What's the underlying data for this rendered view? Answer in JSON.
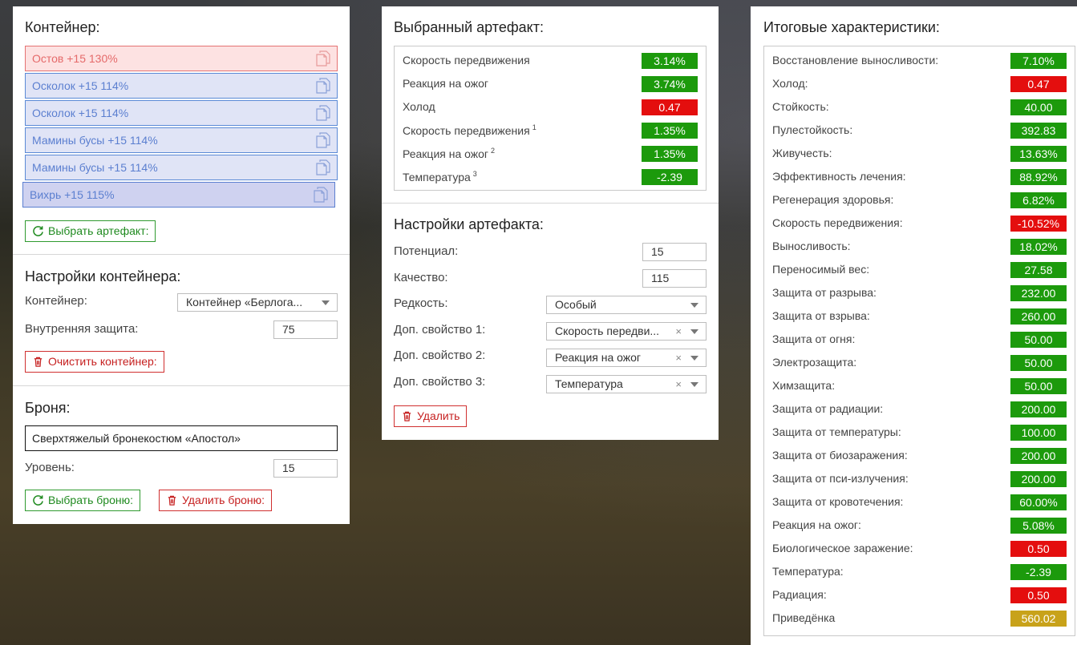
{
  "colors": {
    "positive": "#1c9a0c",
    "negative": "#e40e0e",
    "neutral": "#c8a21a",
    "slot_blue": "#5b7fd0",
    "slot_red": "#e56a6a",
    "btn_green": "#1f8a1f",
    "btn_red": "#c62020"
  },
  "container": {
    "title": "Контейнер:",
    "slots": [
      {
        "label": "Остов +15 130%",
        "style": "red",
        "icon": "copy-doc-icon"
      },
      {
        "label": "Осколок +15 114%",
        "style": "blue",
        "icon": "copy-doc-icon"
      },
      {
        "label": "Осколок +15 114%",
        "style": "blue",
        "icon": "copy-doc-icon"
      },
      {
        "label": "Мамины бусы +15 114%",
        "style": "blue",
        "icon": "copy-doc-icon"
      },
      {
        "label": "Мамины бусы +15 114%",
        "style": "blue",
        "icon": "copy-doc-icon"
      },
      {
        "label": "Вихрь +15 115%",
        "style": "active",
        "icon": "copy-doc-icon"
      }
    ],
    "select_artifact_label": "Выбрать артефакт:"
  },
  "container_settings": {
    "title": "Настройки контейнера:",
    "container_label": "Контейнер:",
    "container_value": "Контейнер «Берлога...",
    "internal_protection_label": "Внутренняя защита:",
    "internal_protection_value": "75",
    "clear_label": "Очистить контейнер:"
  },
  "armor": {
    "title": "Броня:",
    "name": "Сверхтяжелый бронекостюм «Апостол»",
    "level_label": "Уровень:",
    "level_value": "15",
    "select_label": "Выбрать броню:",
    "delete_label": "Удалить броню:"
  },
  "selected_artifact": {
    "title": "Выбранный артефакт:",
    "stats": [
      {
        "name": "Скорость передвижения",
        "sup": "",
        "value": "3.14%",
        "tone": "green"
      },
      {
        "name": "Реакция на ожог",
        "sup": "",
        "value": "3.74%",
        "tone": "green"
      },
      {
        "name": "Холод",
        "sup": "",
        "value": "0.47",
        "tone": "red"
      },
      {
        "name": "Скорость передвижения",
        "sup": "1",
        "value": "1.35%",
        "tone": "green"
      },
      {
        "name": "Реакция на ожог",
        "sup": "2",
        "value": "1.35%",
        "tone": "green"
      },
      {
        "name": "Температура",
        "sup": "3",
        "value": "-2.39",
        "tone": "green"
      }
    ]
  },
  "artifact_settings": {
    "title": "Настройки артефакта:",
    "potential_label": "Потенциал:",
    "potential_value": "15",
    "quality_label": "Качество:",
    "quality_value": "115",
    "rarity_label": "Редкость:",
    "rarity_value": "Особый",
    "extra1_label": "Доп. свойство 1:",
    "extra1_value": "Скорость передви...",
    "extra2_label": "Доп. свойство 2:",
    "extra2_value": "Реакция на ожог",
    "extra3_label": "Доп. свойство 3:",
    "extra3_value": "Температура",
    "clear_symbol": "×",
    "delete_label": "Удалить"
  },
  "totals": {
    "title": "Итоговые характеристики:",
    "stats": [
      {
        "name": "Восстановление выносливости:",
        "value": "7.10%",
        "tone": "green"
      },
      {
        "name": "Холод:",
        "value": "0.47",
        "tone": "red"
      },
      {
        "name": "Стойкость:",
        "value": "40.00",
        "tone": "green"
      },
      {
        "name": "Пулестойкость:",
        "value": "392.83",
        "tone": "green"
      },
      {
        "name": "Живучесть:",
        "value": "13.63%",
        "tone": "green"
      },
      {
        "name": "Эффективность лечения:",
        "value": "88.92%",
        "tone": "green"
      },
      {
        "name": "Регенерация здоровья:",
        "value": "6.82%",
        "tone": "green"
      },
      {
        "name": "Скорость передвижения:",
        "value": "-10.52%",
        "tone": "red"
      },
      {
        "name": "Выносливость:",
        "value": "18.02%",
        "tone": "green"
      },
      {
        "name": "Переносимый вес:",
        "value": "27.58",
        "tone": "green"
      },
      {
        "name": "Защита от разрыва:",
        "value": "232.00",
        "tone": "green"
      },
      {
        "name": "Защита от взрыва:",
        "value": "260.00",
        "tone": "green"
      },
      {
        "name": "Защита от огня:",
        "value": "50.00",
        "tone": "green"
      },
      {
        "name": "Электрозащита:",
        "value": "50.00",
        "tone": "green"
      },
      {
        "name": "Химзащита:",
        "value": "50.00",
        "tone": "green"
      },
      {
        "name": "Защита от радиации:",
        "value": "200.00",
        "tone": "green"
      },
      {
        "name": "Защита от температуры:",
        "value": "100.00",
        "tone": "green"
      },
      {
        "name": "Защита от биозаражения:",
        "value": "200.00",
        "tone": "green"
      },
      {
        "name": "Защита от пси-излучения:",
        "value": "200.00",
        "tone": "green"
      },
      {
        "name": "Защита от кровотечения:",
        "value": "60.00%",
        "tone": "green"
      },
      {
        "name": "Реакция на ожог:",
        "value": "5.08%",
        "tone": "green"
      },
      {
        "name": "Биологическое заражение:",
        "value": "0.50",
        "tone": "red"
      },
      {
        "name": "Температура:",
        "value": "-2.39",
        "tone": "green"
      },
      {
        "name": "Радиация:",
        "value": "0.50",
        "tone": "red"
      },
      {
        "name": "Приведёнка",
        "value": "560.02",
        "tone": "gold"
      }
    ]
  }
}
